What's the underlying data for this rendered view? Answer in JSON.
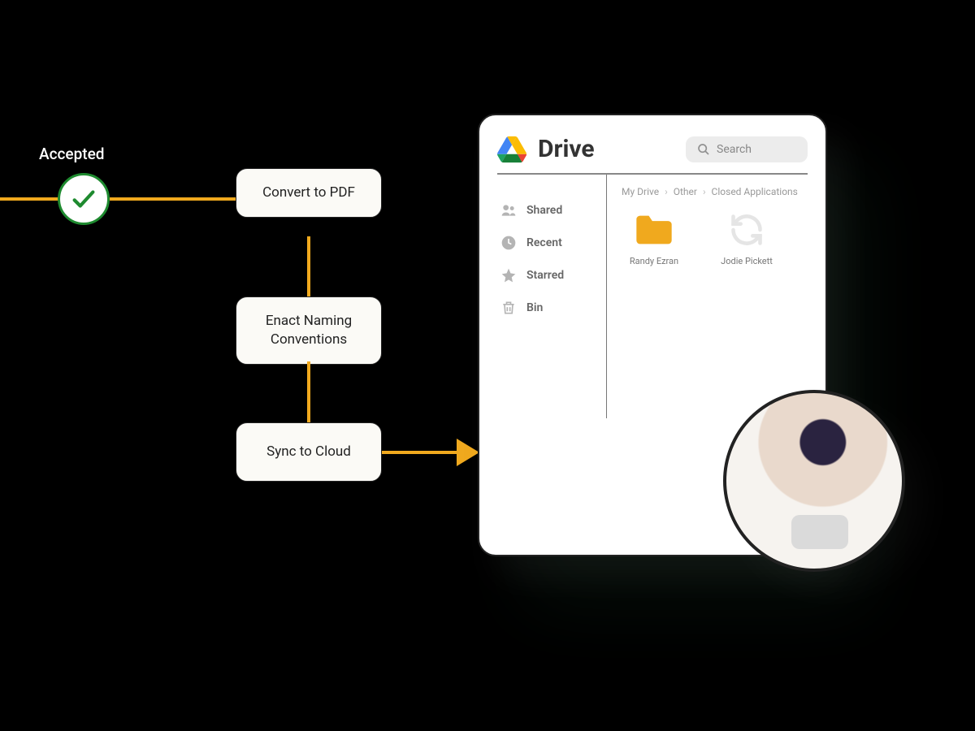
{
  "flow": {
    "accepted_label": "Accepted",
    "steps": [
      "Convert to PDF",
      "Enact Naming Conventions",
      "Sync to Cloud"
    ]
  },
  "drive": {
    "title": "Drive",
    "search_placeholder": "Search",
    "sidebar": [
      {
        "icon": "people-icon",
        "label": "Shared"
      },
      {
        "icon": "clock-icon",
        "label": "Recent"
      },
      {
        "icon": "star-icon",
        "label": "Starred"
      },
      {
        "icon": "trash-icon",
        "label": "Bin"
      }
    ],
    "breadcrumb": [
      "My Drive",
      "Other",
      "Closed Applications"
    ],
    "files": [
      {
        "type": "folder",
        "name": "Randy Ezran"
      },
      {
        "type": "syncing",
        "name": "Jodie Pickett"
      }
    ]
  },
  "colors": {
    "accent": "#f0a91e",
    "success": "#1e8a2f"
  }
}
